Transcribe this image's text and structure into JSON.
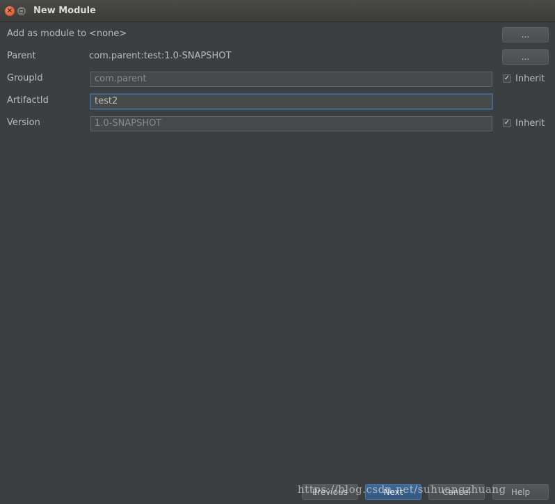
{
  "window": {
    "title": "New Module"
  },
  "titlebar": {
    "close_glyph": "×",
    "close_icon": "close-icon",
    "minimize_icon": "minimize-icon"
  },
  "form": {
    "add_as_module": {
      "label": "Add as module to",
      "value": "<none>",
      "button_label": "..."
    },
    "parent": {
      "label": "Parent",
      "value": "com.parent:test:1.0-SNAPSHOT",
      "button_label": "..."
    },
    "group_id": {
      "label": "GroupId",
      "value": "com.parent",
      "inherit_label": "Inherit",
      "inherit_checked": true
    },
    "artifact_id": {
      "label": "ArtifactId",
      "value": "test2"
    },
    "version": {
      "label": "Version",
      "value": "1.0-SNAPSHOT",
      "inherit_label": "Inherit",
      "inherit_checked": true
    }
  },
  "checkmark": "✓",
  "footer": {
    "previous_label": "Previous",
    "next_label": "Next",
    "cancel_label": "Cancel",
    "help_label": "Help"
  },
  "watermark": {
    "text": "https://blog.csdn.net/suhuangzhuang"
  },
  "colors": {
    "background": "#3c3f41",
    "accent": "#466d94",
    "close_button": "#e05b2f"
  }
}
